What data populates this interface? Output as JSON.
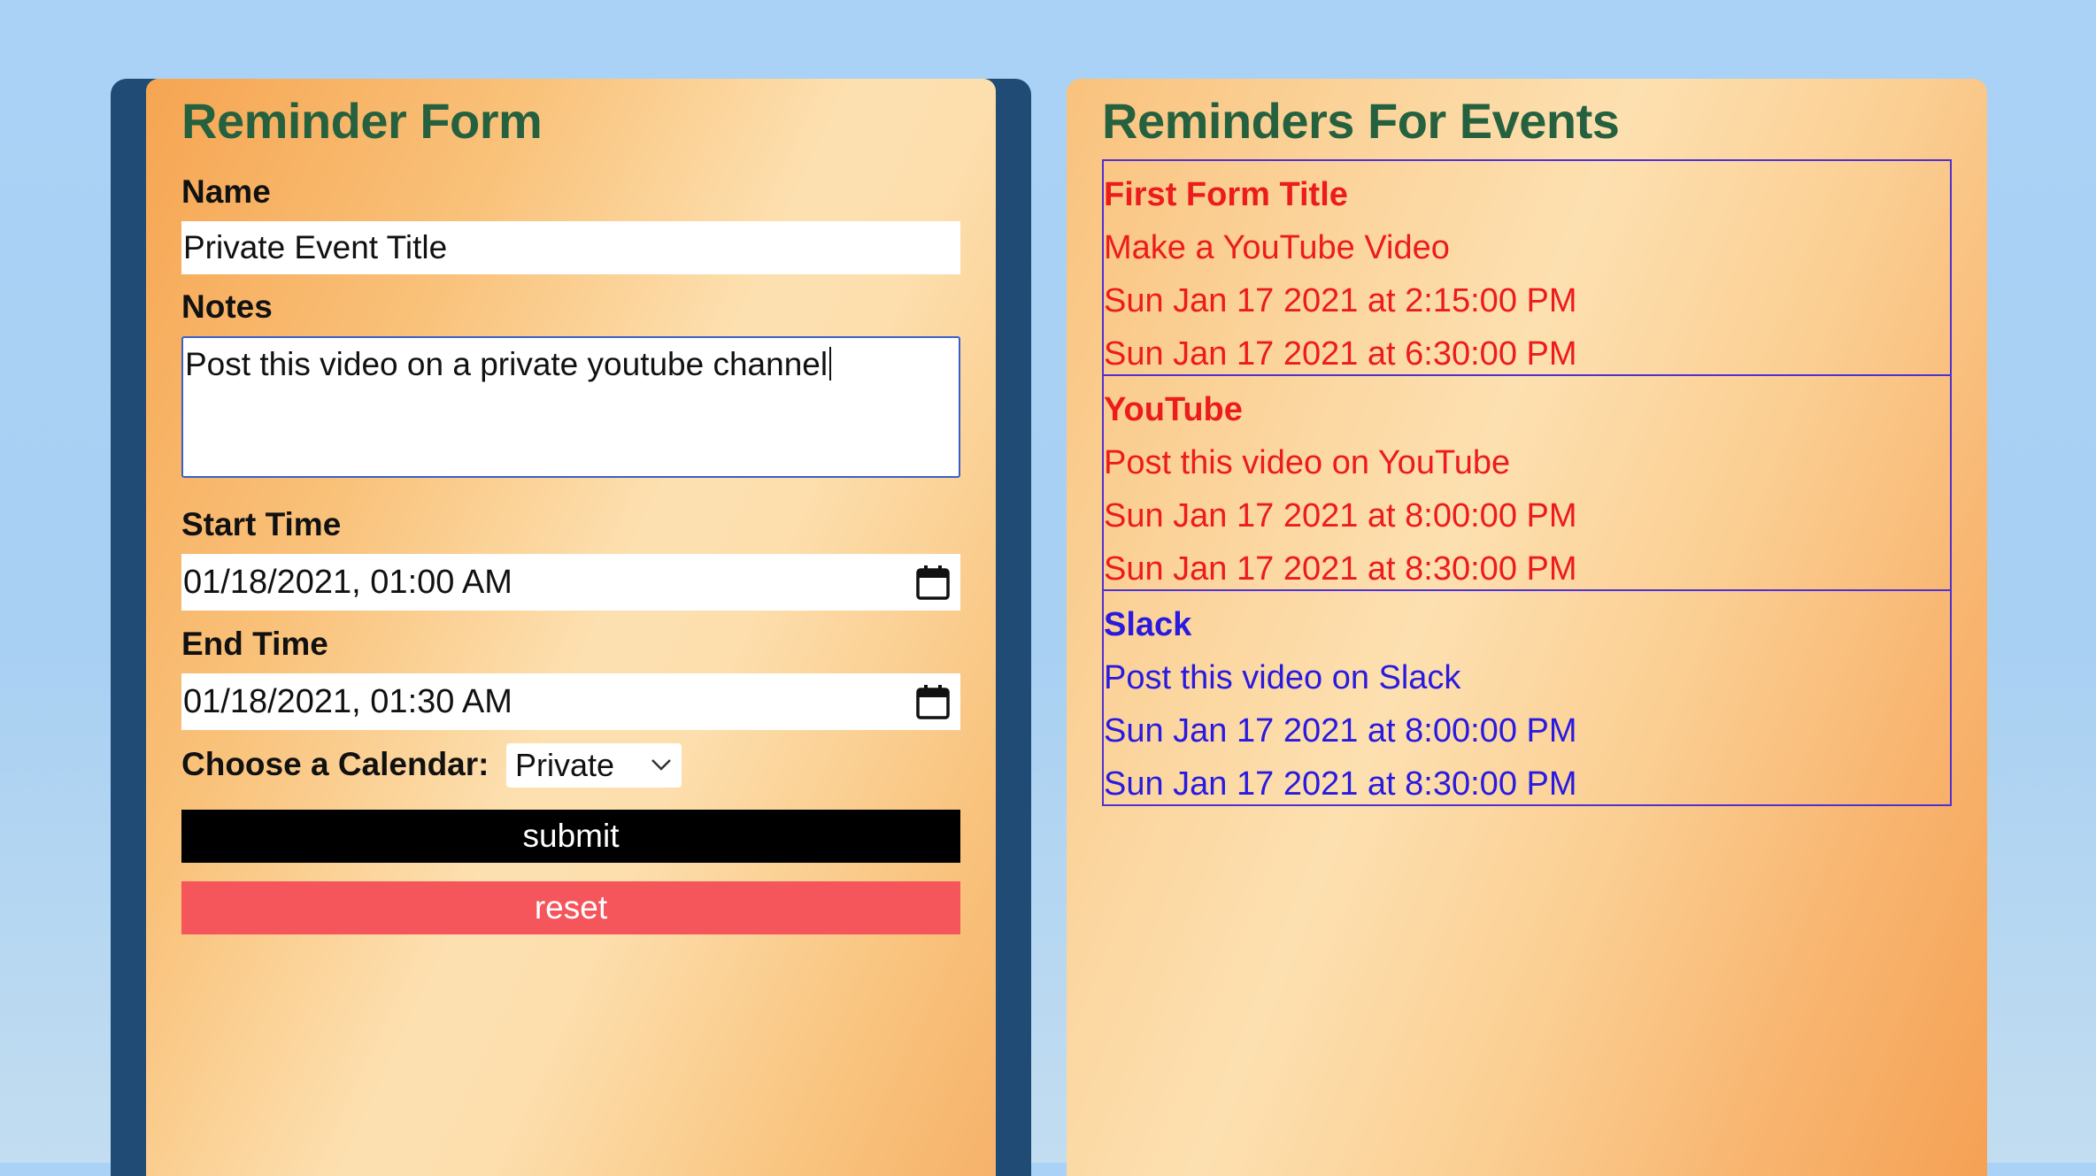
{
  "form": {
    "title": "Reminder Form",
    "name_label": "Name",
    "name_value": "Private Event Title",
    "notes_label": "Notes",
    "notes_value": "Post this video on a private youtube channel",
    "start_label": "Start Time",
    "start_value": "01/18/2021, 01:00  AM",
    "end_label": "End Time",
    "end_value": "01/18/2021, 01:30  AM",
    "calendar_label": "Choose a Calendar:",
    "calendar_value": "Private",
    "submit_label": "submit",
    "reset_label": "reset"
  },
  "events_panel": {
    "title": "Reminders For Events",
    "items": [
      {
        "title": "First Form Title",
        "notes": "Make a YouTube Video",
        "start": "Sun Jan 17 2021 at 2:15:00 PM",
        "end": "Sun Jan 17 2021 at 6:30:00 PM",
        "color": "#ec1c1c"
      },
      {
        "title": "YouTube",
        "notes": "Post this video on YouTube",
        "start": "Sun Jan 17 2021 at 8:00:00 PM",
        "end": "Sun Jan 17 2021 at 8:30:00 PM",
        "color": "#ec1c1c"
      },
      {
        "title": "Slack",
        "notes": "Post this video on Slack",
        "start": "Sun Jan 17 2021 at 8:00:00 PM",
        "end": "Sun Jan 17 2021 at 8:30:00 PM",
        "color": "#2a1ae0"
      }
    ]
  },
  "colors": {
    "heading": "#25613f",
    "submit_bg": "#000000",
    "reset_bg": "#f5565c",
    "frame": "#1f4b75",
    "event_border": "#5030d0"
  },
  "icons": {
    "date_picker": "calendar-icon",
    "select_arrow": "chevron-down-icon"
  }
}
